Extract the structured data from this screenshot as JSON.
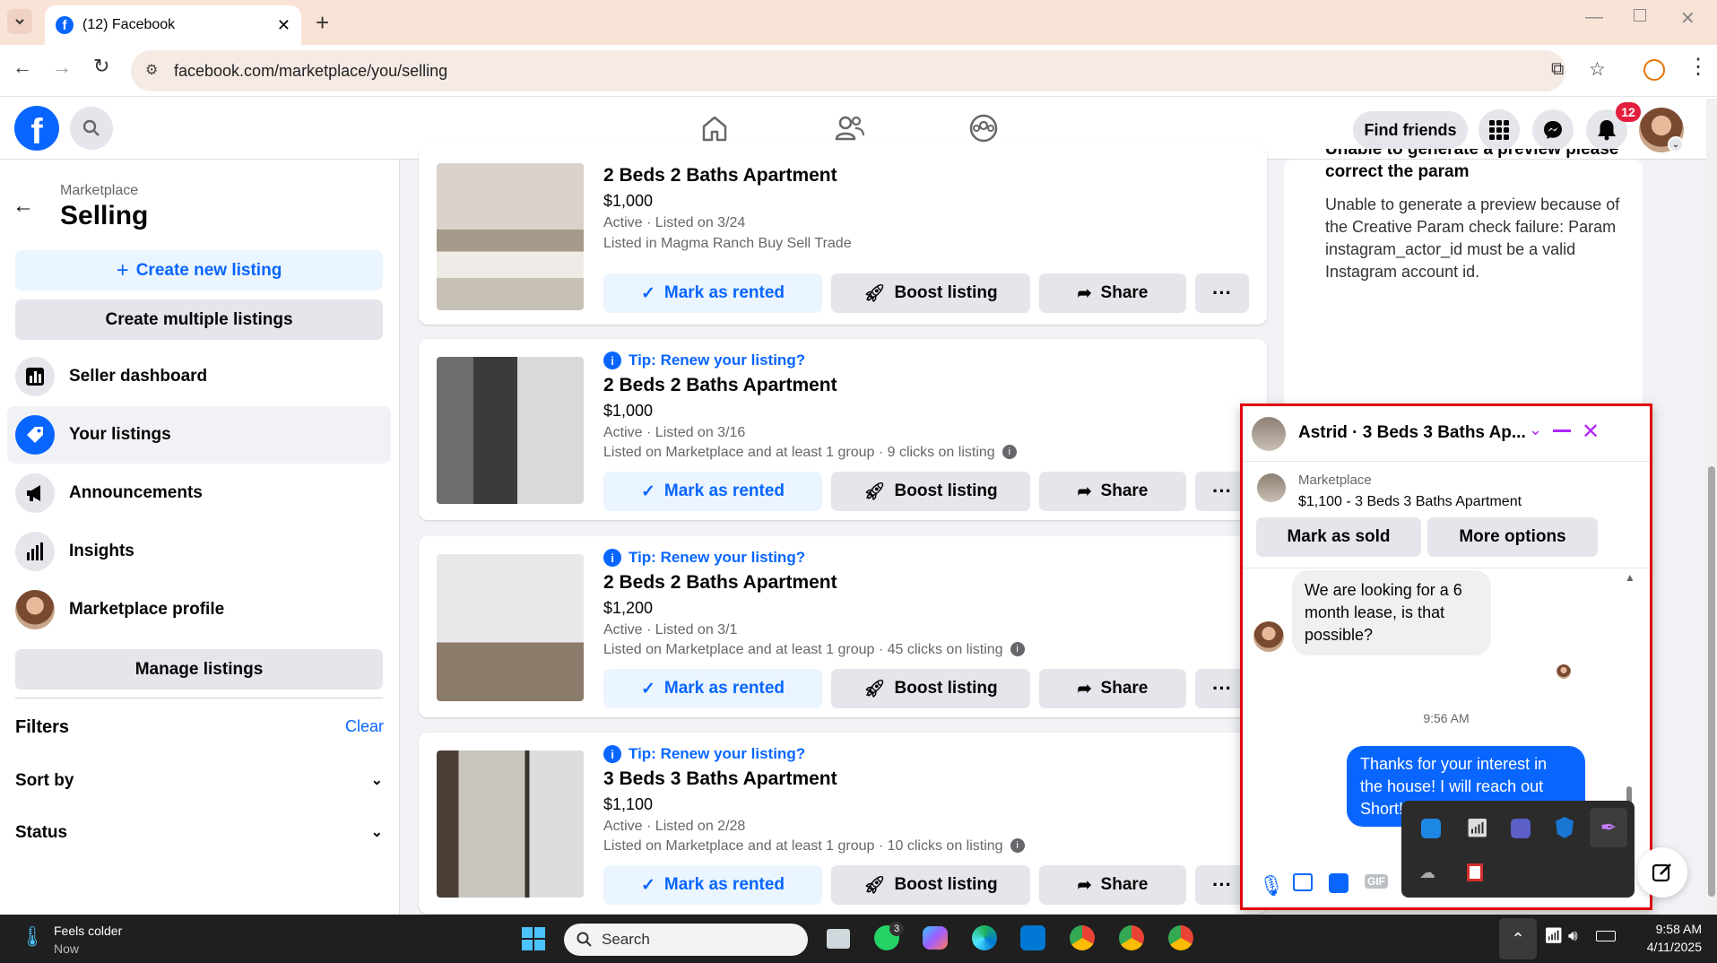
{
  "browser": {
    "tab_title": "(12) Facebook",
    "url": "facebook.com/marketplace/you/selling"
  },
  "header": {
    "find_friends": "Find friends",
    "notification_count": "12"
  },
  "sidebar": {
    "section_label": "Marketplace",
    "title": "Selling",
    "create_new": "Create new listing",
    "create_multiple": "Create multiple listings",
    "nav": [
      "Seller dashboard",
      "Your listings",
      "Announcements",
      "Insights",
      "Marketplace profile"
    ],
    "manage": "Manage listings",
    "filters": "Filters",
    "clear": "Clear",
    "sort_by": "Sort by",
    "status": "Status"
  },
  "listings": [
    {
      "tip": "",
      "title": "2 Beds 2 Baths Apartment",
      "price": "$1,000",
      "status": "Active · Listed on 3/24",
      "detail": "Listed in Magma Ranch Buy Sell Trade"
    },
    {
      "tip": "Tip: Renew your listing?",
      "title": "2 Beds 2 Baths Apartment",
      "price": "$1,000",
      "status": "Active · Listed on 3/16",
      "detail": "Listed on Marketplace and at least 1 group · 9 clicks on listing"
    },
    {
      "tip": "Tip: Renew your listing?",
      "title": "2 Beds 2 Baths Apartment",
      "price": "$1,200",
      "status": "Active · Listed on 3/1",
      "detail": "Listed on Marketplace and at least 1 group · 45 clicks on listing"
    },
    {
      "tip": "Tip: Renew your listing?",
      "title": "3 Beds 3 Baths Apartment",
      "price": "$1,100",
      "status": "Active · Listed on 2/28",
      "detail": "Listed on Marketplace and at least 1 group · 10 clicks on listing"
    }
  ],
  "listing_buttons": {
    "mark": "Mark as rented",
    "boost": "Boost listing",
    "share": "Share"
  },
  "preview_panel": {
    "heading": "Unable to generate a preview please correct the param",
    "body": "Unable to generate a preview because of the Creative Param check failure: Param instagram_actor_id must be a valid Instagram account id."
  },
  "chat": {
    "title": "Astrid · 3 Beds 3 Baths Ap...",
    "context_label": "Marketplace",
    "context_item": "$1,100 - 3 Beds 3 Baths Apartment",
    "mark_sold": "Mark as sold",
    "more_options": "More options",
    "incoming": "We are looking for a 6 month lease, is that possible?",
    "timestamp": "9:56 AM",
    "outgoing": "Thanks for your interest in the house! I will reach out Short!"
  },
  "taskbar": {
    "weather_line1": "Feels colder",
    "weather_line2": "Now",
    "search": "Search",
    "whatsapp_badge": "3",
    "time": "9:58 AM",
    "date": "4/11/2025"
  },
  "colors": {
    "fb_blue": "#0866ff",
    "highlight_red": "#e0000d",
    "notify_red": "#e41e3f"
  }
}
